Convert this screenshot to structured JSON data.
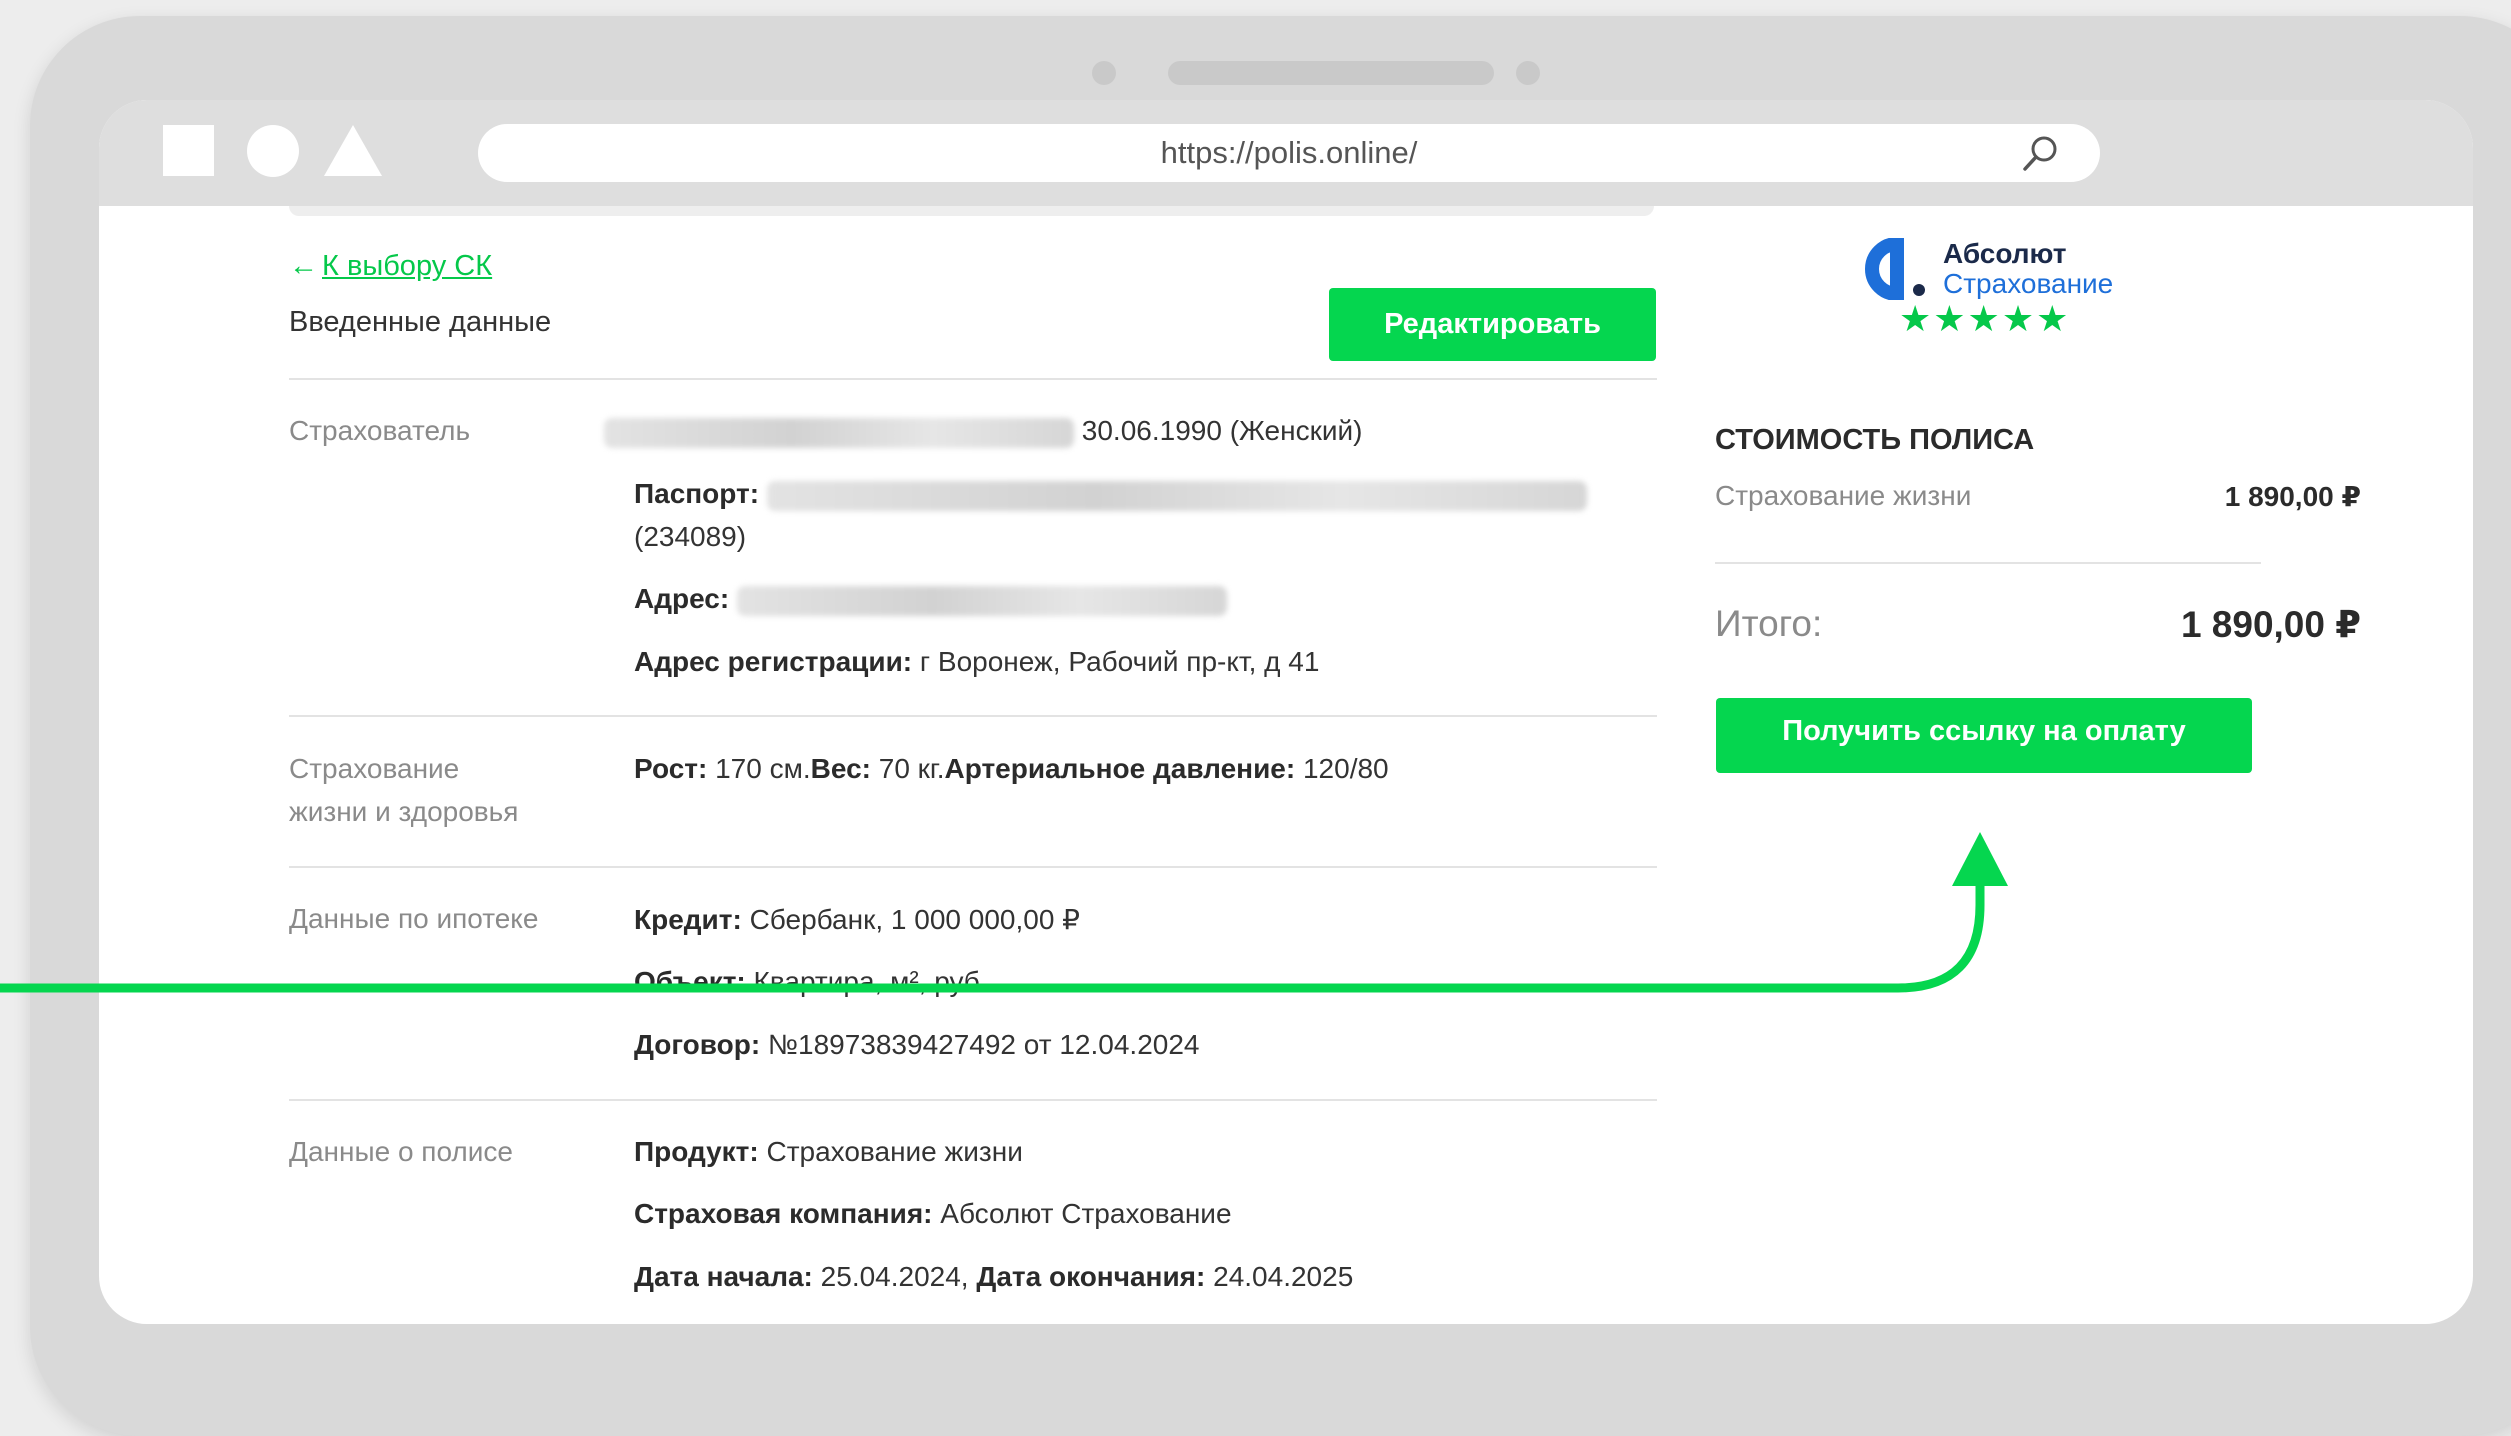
{
  "browser": {
    "url": "https://polis.online/"
  },
  "header": {
    "back_arrow": "←",
    "back_link": "К выбору СК",
    "section_title": "Введенные данные",
    "edit_button": "Редактировать"
  },
  "insurer": {
    "logo_text_1": "Абсолют",
    "logo_text_2": "Страхование",
    "stars": "★★★★★",
    "rating": 5
  },
  "sections": {
    "policyholder": {
      "label": "Страхователь",
      "birth": "30.06.1990 (Женский)",
      "passport_label": "Паспорт:",
      "passport_code": "(234089)",
      "address_label": "Адрес:",
      "reg_address_label": "Адрес регистрации:",
      "reg_address": "г Воронеж, Рабочий пр-кт, д 41"
    },
    "health": {
      "label_line1": "Страхование",
      "label_line2": "жизни и здоровья",
      "height_label": "Рост:",
      "height_value": "170 см.",
      "weight_label": "Вес:",
      "weight_value": "70 кг.",
      "pressure_label": "Артериальное давление:",
      "pressure_value": "120/80"
    },
    "mortgage": {
      "label": "Данные по ипотеке",
      "credit_label": "Кредит:",
      "credit_value": "Сбербанк, 1 000 000,00 ₽",
      "object_label": "Объект:",
      "object_value": "Квартира, м², руб.",
      "contract_label": "Договор:",
      "contract_value": "№18973839427492 от 12.04.2024"
    },
    "policy": {
      "label": "Данные о полисе",
      "product_label": "Продукт:",
      "product_value": "Страхование жизни",
      "company_label": "Страховая компания:",
      "company_value": "Абсолют Страхование",
      "start_label": "Дата начала:",
      "start_value": "25.04.2024,",
      "end_label": "Дата окончания:",
      "end_value": "24.04.2025"
    }
  },
  "cost": {
    "title": "СТОИМОСТЬ ПОЛИСА",
    "item_label": "Страхование жизни",
    "item_value": "1 890,00 ₽",
    "total_label": "Итого:",
    "total_value": "1 890,00 ₽",
    "pay_button": "Получить ссылку на оплату"
  },
  "colors": {
    "accent_green": "#05d64f",
    "logo_blue": "#1e6fd9",
    "logo_dark": "#1b2a4a"
  }
}
